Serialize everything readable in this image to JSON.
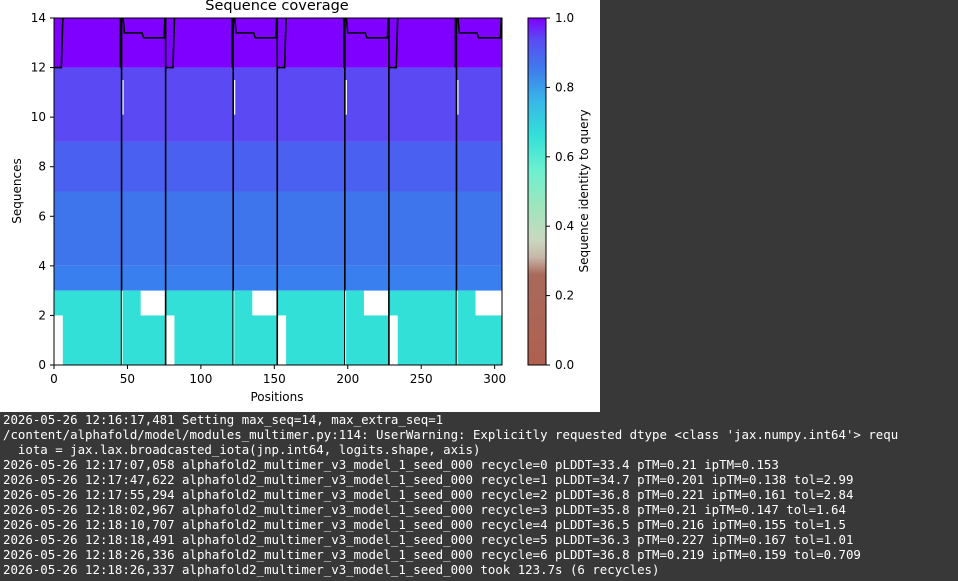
{
  "chart_data": {
    "type": "heatmap",
    "title": "Sequence coverage",
    "xlabel": "Positions",
    "ylabel": "Sequences",
    "xlim": [
      0,
      305
    ],
    "ylim": [
      0,
      14
    ],
    "x_ticks": [
      0,
      50,
      100,
      150,
      200,
      250,
      300
    ],
    "y_ticks": [
      0,
      2,
      4,
      6,
      8,
      10,
      12,
      14
    ],
    "chain_breaks": [
      46,
      76,
      122,
      152,
      198,
      228,
      274
    ],
    "colorbar": {
      "label": "Sequence identity to query",
      "colormap": "rainbow_r",
      "range": [
        0.0,
        1.0
      ],
      "ticks": [
        0.0,
        0.2,
        0.4,
        0.6,
        0.8,
        1.0
      ]
    },
    "rows": [
      {
        "y": [
          12,
          14
        ],
        "identity": 1.0,
        "color": "#8000ff"
      },
      {
        "y": [
          9,
          12
        ],
        "identity": 0.88,
        "color": "#5b4af4"
      },
      {
        "y": [
          7,
          9
        ],
        "identity": 0.82,
        "color": "#4a60f0"
      },
      {
        "y": [
          4,
          7
        ],
        "identity": 0.78,
        "color": "#3f75ec"
      },
      {
        "y": [
          3,
          4
        ],
        "identity": 0.76,
        "color": "#3a7ff0"
      },
      {
        "y": [
          0,
          3
        ],
        "identity": 0.58,
        "color": "#33e0d8"
      }
    ],
    "gaps": [
      {
        "x": [
          59,
          76
        ],
        "y": [
          2,
          3
        ]
      },
      {
        "x": [
          135,
          152
        ],
        "y": [
          2,
          3
        ]
      },
      {
        "x": [
          211,
          228
        ],
        "y": [
          2,
          3
        ]
      },
      {
        "x": [
          287,
          305
        ],
        "y": [
          2,
          3
        ]
      },
      {
        "x": [
          0,
          6
        ],
        "y": [
          0,
          2
        ]
      },
      {
        "x": [
          76,
          82
        ],
        "y": [
          0,
          2
        ]
      },
      {
        "x": [
          152,
          158
        ],
        "y": [
          0,
          2
        ]
      },
      {
        "x": [
          228,
          234
        ],
        "y": [
          0,
          2
        ]
      }
    ]
  },
  "console": {
    "lines": [
      "2026-05-26 12:16:17,481 Setting max_seq=14, max_extra_seq=1",
      "/content/alphafold/model/modules_multimer.py:114: UserWarning: Explicitly requested dtype <class 'jax.numpy.int64'> requ",
      "  iota = jax.lax.broadcasted_iota(jnp.int64, logits.shape, axis)",
      "2026-05-26 12:17:07,058 alphafold2_multimer_v3_model_1_seed_000 recycle=0 pLDDT=33.4 pTM=0.21 ipTM=0.153",
      "2026-05-26 12:17:47,622 alphafold2_multimer_v3_model_1_seed_000 recycle=1 pLDDT=34.7 pTM=0.201 ipTM=0.138 tol=2.99",
      "2026-05-26 12:17:55,294 alphafold2_multimer_v3_model_1_seed_000 recycle=2 pLDDT=36.8 pTM=0.221 ipTM=0.161 tol=2.84",
      "2026-05-26 12:18:02,967 alphafold2_multimer_v3_model_1_seed_000 recycle=3 pLDDT=35.8 pTM=0.21 ipTM=0.147 tol=1.64",
      "2026-05-26 12:18:10,707 alphafold2_multimer_v3_model_1_seed_000 recycle=4 pLDDT=36.5 pTM=0.216 ipTM=0.155 tol=1.5",
      "2026-05-26 12:18:18,491 alphafold2_multimer_v3_model_1_seed_000 recycle=5 pLDDT=36.3 pTM=0.227 ipTM=0.167 tol=1.01",
      "2026-05-26 12:18:26,336 alphafold2_multimer_v3_model_1_seed_000 recycle=6 pLDDT=36.8 pTM=0.219 ipTM=0.159 tol=0.709",
      "2026-05-26 12:18:26,337 alphafold2_multimer_v3_model_1_seed_000 took 123.7s (6 recycles)"
    ]
  }
}
